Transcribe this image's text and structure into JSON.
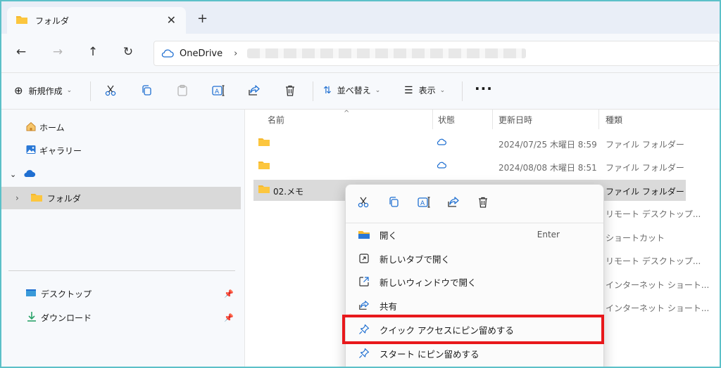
{
  "colors": {
    "accent": "#1f6fd1",
    "folder": "#f5b82e",
    "highlight": "#e8181b"
  },
  "tab": {
    "title": "フォルダ",
    "close_icon": "close-icon",
    "new_tab_icon": "plus-icon"
  },
  "nav": {
    "location": "OneDrive"
  },
  "toolbar": {
    "new_label": "新規作成",
    "sort_label": "並べ替え",
    "view_label": "表示"
  },
  "sidebar": {
    "home": "ホーム",
    "gallery": "ギャラリー",
    "folder": "フォルダ",
    "desktop": "デスクトップ",
    "downloads": "ダウンロード"
  },
  "columns": {
    "name": "名前",
    "status": "状態",
    "modified": "更新日時",
    "type": "種類"
  },
  "rows": [
    {
      "name": "",
      "date": "2024/07/25 木曜日 8:59",
      "type": "ファイル フォルダー"
    },
    {
      "name": "",
      "date": "2024/08/08 木曜日 8:51",
      "type": "ファイル フォルダー"
    },
    {
      "name": "02.メモ",
      "date": "",
      "type": "ファイル フォルダー"
    }
  ],
  "row_types_tail": [
    "リモート デスクトップ...",
    "ショートカット",
    "リモート デスクトップ...",
    "インターネット ショート...",
    "インターネット ショート..."
  ],
  "context_menu": {
    "items": [
      {
        "label": "開く",
        "shortcut": "Enter"
      },
      {
        "label": "新しいタブで開く"
      },
      {
        "label": "新しいウィンドウで開く"
      },
      {
        "label": "共有"
      },
      {
        "label": "クイック アクセスにピン留めする"
      },
      {
        "label": "スタート にピン留めする"
      }
    ]
  }
}
